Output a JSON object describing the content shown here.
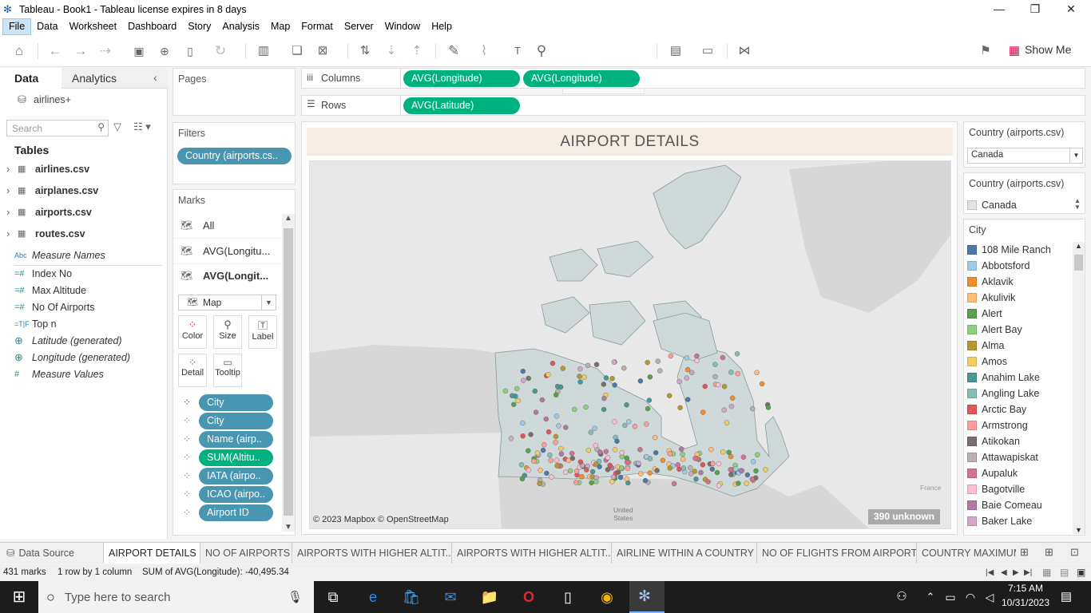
{
  "window": {
    "title": "Tableau - Book1 - Tableau license expires in 8 days"
  },
  "menu": [
    "File",
    "Data",
    "Worksheet",
    "Dashboard",
    "Story",
    "Analysis",
    "Map",
    "Format",
    "Server",
    "Window",
    "Help"
  ],
  "toolbar": {
    "show_me": "Show Me"
  },
  "left": {
    "tab_data": "Data",
    "tab_analytics": "Analytics",
    "datasource": "airlines+",
    "search_placeholder": "Search",
    "tables_header": "Tables",
    "tables": [
      "airlines.csv",
      "airplanes.csv",
      "airports.csv",
      "routes.csv"
    ],
    "fields": [
      {
        "icon": "Abc",
        "name": "Measure Names",
        "italic": true
      },
      {
        "icon": "#",
        "name": "Index No",
        "italic": false
      },
      {
        "icon": "#",
        "name": "Max Altitude",
        "italic": false
      },
      {
        "icon": "#",
        "name": "No Of Airports",
        "italic": false
      },
      {
        "icon": "T|F",
        "name": "Top n",
        "italic": false
      },
      {
        "icon": "globe",
        "name": "Latitude (generated)",
        "italic": true
      },
      {
        "icon": "globe",
        "name": "Longitude (generated)",
        "italic": true
      },
      {
        "icon": "#",
        "name": "Measure Values",
        "italic": true
      }
    ]
  },
  "pages": {
    "title": "Pages"
  },
  "filters": {
    "title": "Filters",
    "pill": "Country (airports.cs.."
  },
  "marks": {
    "title": "Marks",
    "layers": [
      "All",
      "AVG(Longitu...",
      "AVG(Longit..."
    ],
    "type": "Map",
    "buttons": [
      "Color",
      "Size",
      "Label",
      "Detail",
      "Tooltip"
    ],
    "pills": [
      {
        "label": "City",
        "kind": "blue",
        "icon": "color"
      },
      {
        "label": "City",
        "kind": "blue",
        "icon": "detail"
      },
      {
        "label": "Name (airp..",
        "kind": "blue",
        "icon": "detail"
      },
      {
        "label": "SUM(Altitu..",
        "kind": "green",
        "icon": "detail"
      },
      {
        "label": "IATA (airpo..",
        "kind": "blue",
        "icon": "detail"
      },
      {
        "label": "ICAO (airpo..",
        "kind": "blue",
        "icon": "detail"
      },
      {
        "label": "Airport ID",
        "kind": "blue",
        "icon": "detail"
      }
    ]
  },
  "shelves": {
    "columns_label": "Columns",
    "rows_label": "Rows",
    "columns": [
      "AVG(Longitude)",
      "AVG(Longitude)"
    ],
    "rows": [
      "AVG(Latitude)"
    ]
  },
  "viz": {
    "title": "AIRPORT DETAILS",
    "attribution": "© 2023 Mapbox © OpenStreetMap",
    "unknown": "390 unknown",
    "bg_label_us": "United\nStates",
    "bg_label_fr": "France"
  },
  "right": {
    "filter1_title": "Country (airports.csv)",
    "filter1_value": "Canada",
    "filter2_title": "Country (airports.csv)",
    "filter2_value": "Canada",
    "legend_title": "City",
    "legend": [
      {
        "name": "108 Mile Ranch",
        "color": "#4e79a7"
      },
      {
        "name": "Abbotsford",
        "color": "#a0cbe8"
      },
      {
        "name": "Aklavik",
        "color": "#f28e2b"
      },
      {
        "name": "Akulivik",
        "color": "#ffbe7d"
      },
      {
        "name": "Alert",
        "color": "#59a14f"
      },
      {
        "name": "Alert Bay",
        "color": "#8cd17d"
      },
      {
        "name": "Alma",
        "color": "#b6992d"
      },
      {
        "name": "Amos",
        "color": "#f1ce63"
      },
      {
        "name": "Anahim Lake",
        "color": "#499894"
      },
      {
        "name": "Angling Lake",
        "color": "#86bcb6"
      },
      {
        "name": "Arctic Bay",
        "color": "#e15759"
      },
      {
        "name": "Armstrong",
        "color": "#ff9d9a"
      },
      {
        "name": "Atikokan",
        "color": "#79706e"
      },
      {
        "name": "Attawapiskat",
        "color": "#bab0ac"
      },
      {
        "name": "Aupaluk",
        "color": "#d37295"
      },
      {
        "name": "Bagotville",
        "color": "#fabfd2"
      },
      {
        "name": "Baie Comeau",
        "color": "#b07aa1"
      },
      {
        "name": "Baker Lake",
        "color": "#d4a6c8"
      }
    ]
  },
  "sheets": {
    "data_source": "Data Source",
    "tabs": [
      "AIRPORT DETAILS",
      "NO OF AIRPORTS",
      "AIRPORTS WITH HIGHER ALTIT...",
      "AIRPORTS WITH HIGHER ALTIT...",
      "AIRLINE WITHIN A COUNTRY",
      "NO OF FLIGHTS FROM AIRPORTS",
      "COUNTRY MAXIMUM"
    ]
  },
  "status": {
    "marks": "431 marks",
    "rows": "1 row by 1 column",
    "sum": "SUM of AVG(Longitude): -40,495.34"
  },
  "taskbar": {
    "search_placeholder": "Type here to search",
    "time": "7:15 AM",
    "date": "10/31/2023"
  }
}
